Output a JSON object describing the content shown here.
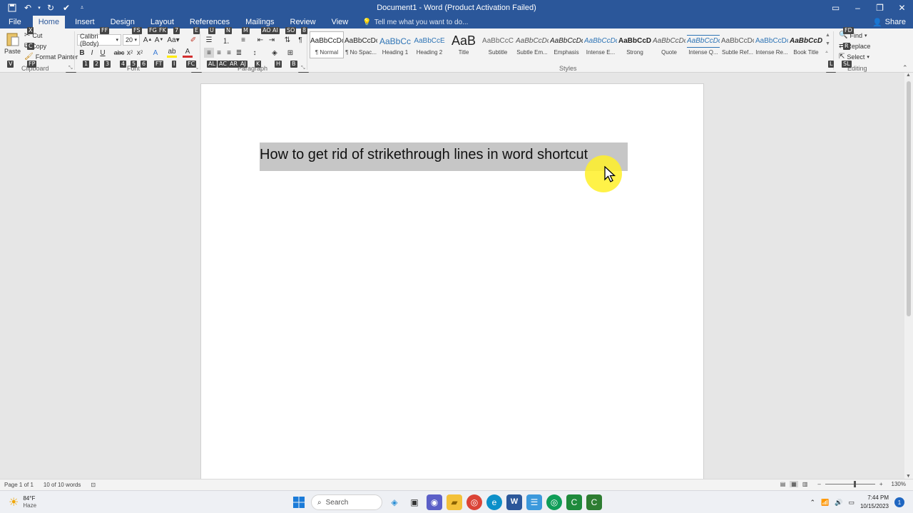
{
  "window": {
    "title": "Document1 - Word (Product Activation Failed)"
  },
  "ribbon_tabs": [
    {
      "label": "File",
      "keytip": ""
    },
    {
      "label": "Home",
      "keytip": "H"
    },
    {
      "label": "Insert",
      "keytip": ""
    },
    {
      "label": "Design",
      "keytip": ""
    },
    {
      "label": "Layout",
      "keytip": ""
    },
    {
      "label": "References",
      "keytip": ""
    },
    {
      "label": "Mailings",
      "keytip": ""
    },
    {
      "label": "Review",
      "keytip": ""
    },
    {
      "label": "View",
      "keytip": ""
    }
  ],
  "tell_me": "Tell me what you want to do...",
  "share": "Share",
  "clipboard": {
    "paste": "Paste",
    "cut": "Cut",
    "copy": "Copy",
    "format_painter": "Format Painter",
    "label": "Clipboard"
  },
  "font": {
    "name": "Calibri (Body)",
    "size": "20",
    "label": "Font"
  },
  "paragraph": {
    "label": "Paragraph"
  },
  "styles": {
    "label": "Styles",
    "items": [
      {
        "sample": "AaBbCcDc",
        "name": "¶ Normal"
      },
      {
        "sample": "AaBbCcDc",
        "name": "¶ No Spac..."
      },
      {
        "sample": "AaBbCc",
        "name": "Heading 1"
      },
      {
        "sample": "AaBbCcE",
        "name": "Heading 2"
      },
      {
        "sample": "AaB",
        "name": "Title"
      },
      {
        "sample": "AaBbCcC",
        "name": "Subtitle"
      },
      {
        "sample": "AaBbCcDc",
        "name": "Subtle Em..."
      },
      {
        "sample": "AaBbCcDc",
        "name": "Emphasis"
      },
      {
        "sample": "AaBbCcDc",
        "name": "Intense E..."
      },
      {
        "sample": "AaBbCcDc",
        "name": "Strong"
      },
      {
        "sample": "AaBbCcDc",
        "name": "Quote"
      },
      {
        "sample": "AaBbCcDc",
        "name": "Intense Q..."
      },
      {
        "sample": "AaBbCcDc",
        "name": "Subtle Ref..."
      },
      {
        "sample": "AaBbCcDc",
        "name": "Intense Re..."
      },
      {
        "sample": "AaBbCcDc",
        "name": "Book Title"
      }
    ]
  },
  "editing": {
    "find": "Find",
    "replace": "Replace",
    "select": "Select",
    "label": "Editing"
  },
  "keytips": {
    "cut": "X",
    "copy": "C",
    "format_painter": "FP",
    "paste": "V",
    "font_name": "FF",
    "font_size": "FS",
    "grow": "FG",
    "shrink": "FK",
    "case": "7",
    "clear": "E",
    "bold": "1",
    "italic": "2",
    "underline": "3",
    "strike": "4",
    "sub": "5",
    "sup": "6",
    "effects": "FT",
    "highlight": "I",
    "color": "FC",
    "bullets": "U",
    "numbering": "N",
    "multilevel": "M",
    "decrease_indent": "AO",
    "increase_indent": "AI",
    "sort": "SO",
    "show": "8",
    "left": "AL",
    "center": "AC",
    "right": "AR",
    "justify": "AJ",
    "spacing": "K",
    "shading": "H",
    "borders": "B",
    "find": "FD",
    "replace": "R",
    "select": "SL",
    "styles_more": "L",
    "clipboard_launcher": "FO",
    "font_launcher": "FN",
    "paragraph_launcher": "PG",
    "styles_launcher": "FY"
  },
  "document": {
    "text": "How to get rid of strikethrough lines in word shortcut"
  },
  "status": {
    "page": "Page 1 of 1",
    "words": "10 of 10 words",
    "zoom": "130%"
  },
  "taskbar": {
    "temp": "84°F",
    "condition": "Haze",
    "search": "Search",
    "time": "7:44 PM",
    "date": "10/15/2023",
    "notifications": "1"
  },
  "colors": {
    "word_blue": "#2b579a",
    "selection": "#c6c6c6",
    "cursor_highlight": "#fff028"
  }
}
